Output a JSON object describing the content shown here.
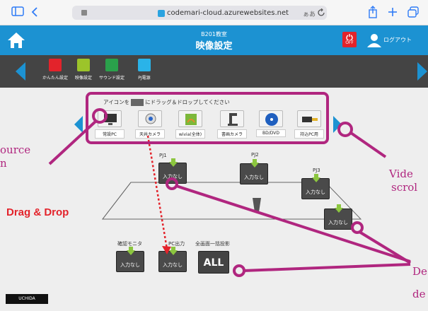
{
  "browser": {
    "url": "codemari-cloud.azurewebsites.net",
    "lang": "ぁあ"
  },
  "header": {
    "room": "B201教室",
    "title": "映像設定",
    "power": "OFF",
    "logout": "ログアウト"
  },
  "toolbar": {
    "items": [
      {
        "label": "かんたん設定",
        "color": "#e3232b"
      },
      {
        "label": "映像設定",
        "color": "#9cc42a"
      },
      {
        "label": "サウンド設定",
        "color": "#2aa14b"
      },
      {
        "label": "PJ電源",
        "color": "#2ab3e8"
      }
    ]
  },
  "sources": {
    "hint_pre": "アイコンを",
    "hint_post": "にドラッグ＆ドロップしてください",
    "items": [
      {
        "label": "常設PC"
      },
      {
        "label": "天井カメラ"
      },
      {
        "label": "wivia(全体)"
      },
      {
        "label": "書画カメラ"
      },
      {
        "label": "BD/DVD"
      },
      {
        "label": "持込PC用"
      }
    ]
  },
  "destinations": {
    "pj1_label": "PJ1",
    "pj2_label": "PJ2",
    "pj3_label": "PJ3",
    "monitor_label": "確認モニタ",
    "pc_out_label": "PC出力",
    "all_label": "全画面一括投影",
    "empty": "入力なし",
    "all_button": "ALL"
  },
  "annotations": {
    "source_1": "ource",
    "source_2": "n",
    "video_1": "Vide",
    "video_2": "scrol",
    "dest_1": "De",
    "dest_2": "de",
    "drag": "Drag & Drop"
  },
  "brand": "UCHIDA"
}
